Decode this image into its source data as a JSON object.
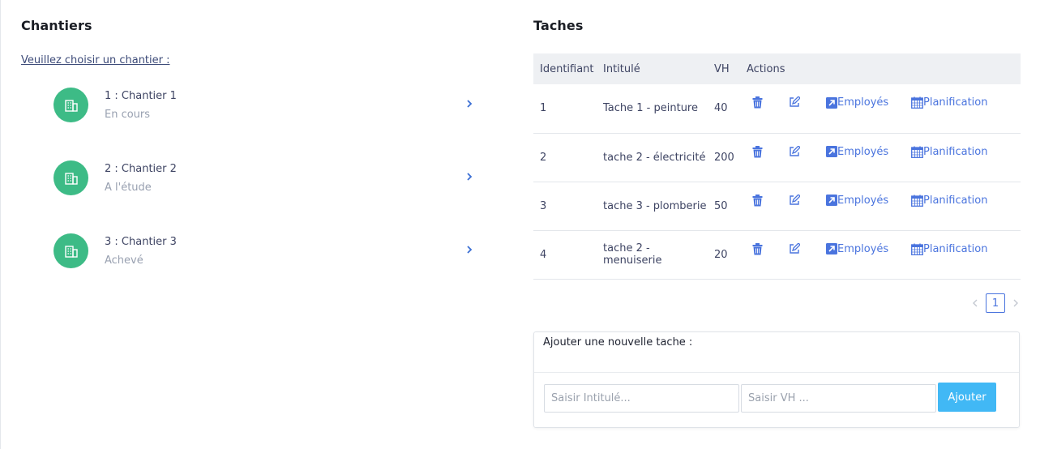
{
  "chantiers": {
    "title": "Chantiers",
    "choose_label": "Veuillez choisir un chantier :",
    "items": [
      {
        "name": "1 : Chantier 1",
        "status": "En cours"
      },
      {
        "name": "2 : Chantier 2",
        "status": "A l'étude"
      },
      {
        "name": "3 : Chantier 3",
        "status": "Achevé"
      }
    ],
    "avatar_color": "#3dbb86",
    "avatar_icon": "building-icon",
    "chevron_icon": "chevron-right-icon"
  },
  "taches": {
    "title": "Taches",
    "columns": [
      "Identifiant",
      "Intitulé",
      "VH",
      "Actions"
    ],
    "rows": [
      {
        "id": "1",
        "title": "Tache 1 - peinture",
        "vh": "40"
      },
      {
        "id": "2",
        "title": "tache 2 - électricité",
        "vh": "200"
      },
      {
        "id": "3",
        "title": "tache 3 - plomberie",
        "vh": "50"
      },
      {
        "id": "4",
        "title": "tache 2 - menuiserie",
        "vh": "20"
      }
    ],
    "action_labels": {
      "employes": "Employés",
      "planification": "Planification"
    },
    "action_icons": [
      "trash-icon",
      "edit-icon",
      "external-link-icon",
      "calendar-icon"
    ],
    "action_color": "#4a74de",
    "pagination": {
      "current_page": "1"
    }
  },
  "add_form": {
    "title": "Ajouter une nouvelle tache :",
    "intitule_placeholder": "Saisir Intitulé...",
    "vh_placeholder": "Saisir VH ...",
    "submit_label": "Ajouter",
    "submit_color": "#41b8f5"
  }
}
